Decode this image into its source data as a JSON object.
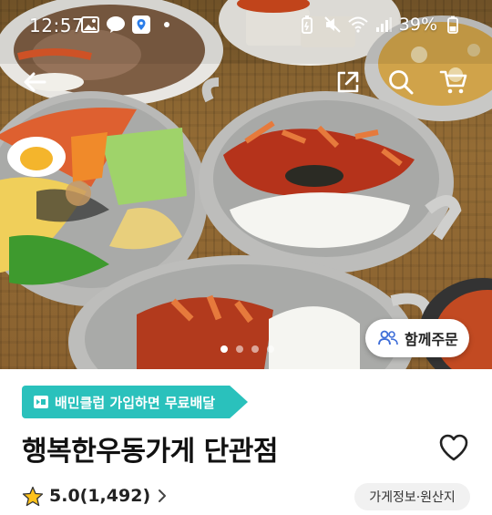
{
  "status_bar": {
    "time": "12:57",
    "battery": "39%",
    "left_icons": [
      "gallery-icon",
      "kakaotalk-icon",
      "map-pin-app-icon",
      "dot-icon"
    ],
    "right_icons": [
      "battery-saver-icon",
      "mute-icon",
      "wifi-icon",
      "signal-icon",
      "battery-icon"
    ]
  },
  "header": {
    "icons": [
      "back-arrow-icon",
      "share-icon",
      "search-icon",
      "cart-icon"
    ]
  },
  "carousel": {
    "current_slide": 1,
    "total_slides": 4
  },
  "group_order": {
    "label": "함께주문",
    "icon": "people-icon"
  },
  "club_banner": {
    "label": "배민클럽 가입하면 무료배달",
    "icon": "baemin-club-icon",
    "color": "#2ac1bc"
  },
  "store": {
    "name": "행복한우동가게 단관점",
    "rating": "5.0(1,492)",
    "rating_icon": "star-icon",
    "info_button": "가게정보·원산지"
  }
}
